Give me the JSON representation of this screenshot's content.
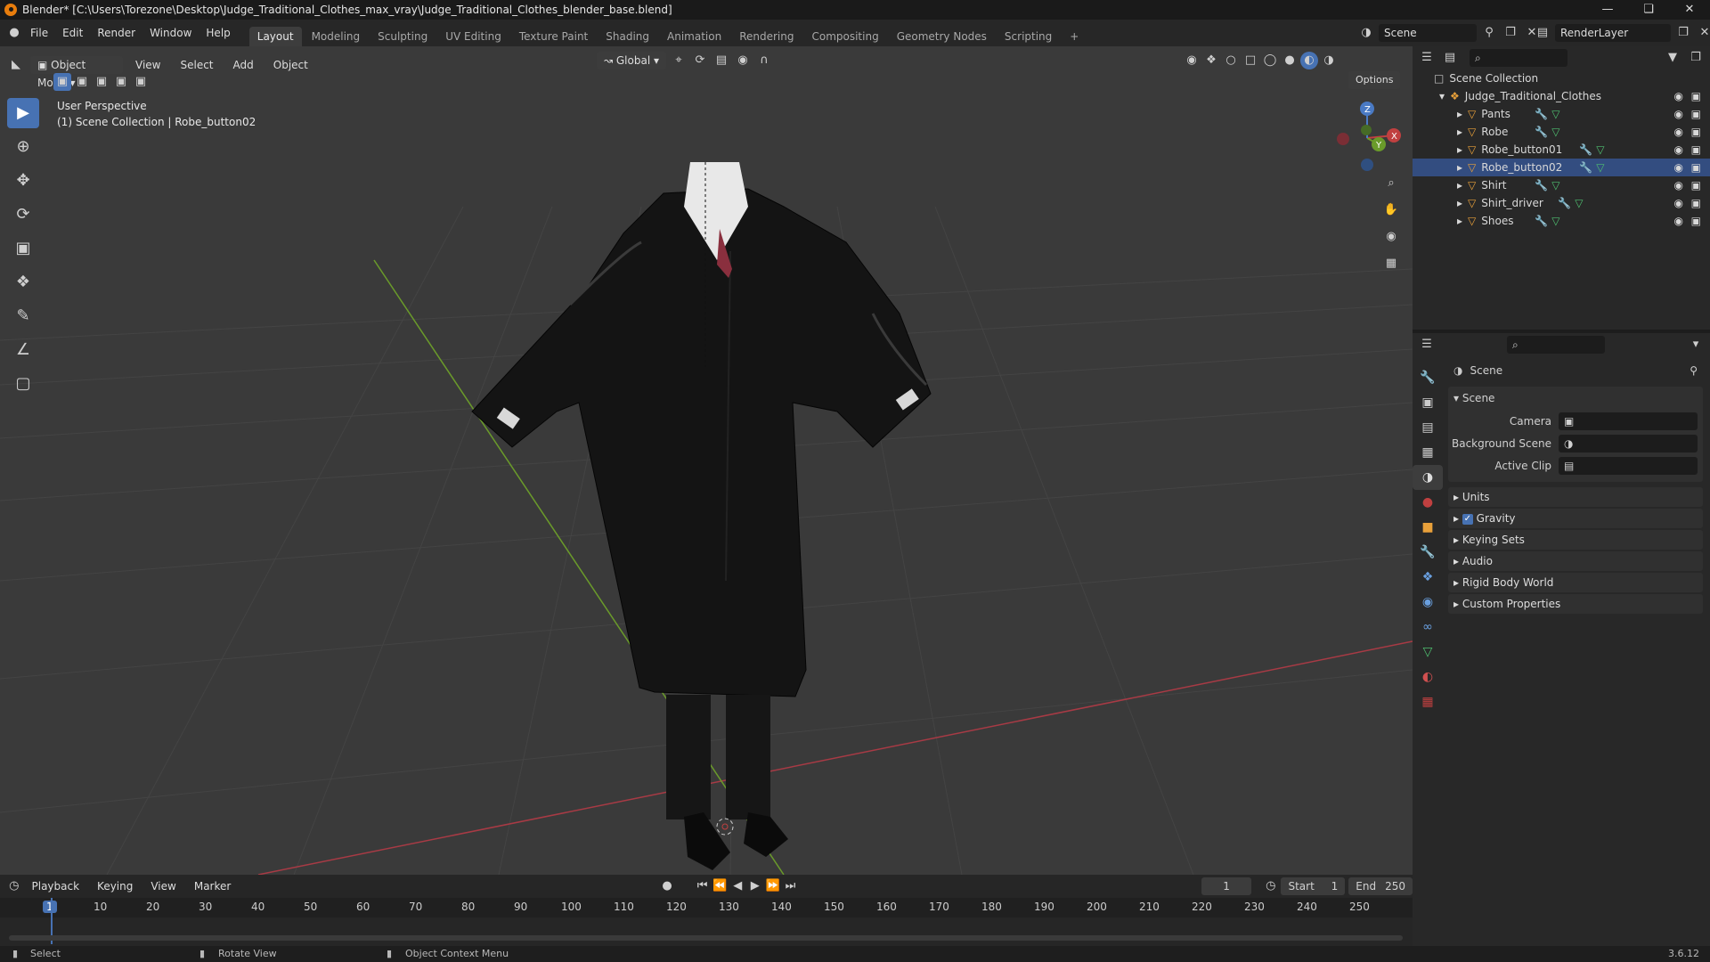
{
  "window": {
    "title": "Blender* [C:\\Users\\Torezone\\Desktop\\Judge_Traditional_Clothes_max_vray\\Judge_Traditional_Clothes_blender_base.blend]"
  },
  "menu": {
    "items": [
      "File",
      "Edit",
      "Render",
      "Window",
      "Help"
    ]
  },
  "workspaces": [
    "Layout",
    "Modeling",
    "Sculpting",
    "UV Editing",
    "Texture Paint",
    "Shading",
    "Animation",
    "Rendering",
    "Compositing",
    "Geometry Nodes",
    "Scripting"
  ],
  "active_workspace": "Layout",
  "scene_selector": "Scene",
  "render_layer": "RenderLayer",
  "viewport_header": {
    "mode": "Object Mode",
    "menus": [
      "View",
      "Select",
      "Add",
      "Object"
    ],
    "orientation": "Global",
    "options": "Options"
  },
  "viewport": {
    "perspective": "User Perspective",
    "collection": "(1) Scene Collection | Robe_button02",
    "gizmo": {
      "x": "X",
      "y": "Y",
      "z": "Z"
    },
    "grid_color": "#464646",
    "x_axis_color": "#a83a45",
    "y_axis_color": "#6a9b2a"
  },
  "outliner": {
    "root": "Scene Collection",
    "collection": "Judge_Traditional_Clothes",
    "objects": [
      "Pants",
      "Robe",
      "Robe_button01",
      "Robe_button02",
      "Shirt",
      "Shirt_driver",
      "Shoes"
    ],
    "selected": "Robe_button02"
  },
  "properties": {
    "context": "Scene",
    "panel": "Scene",
    "camera_label": "Camera",
    "background_scene_label": "Background Scene",
    "active_clip_label": "Active Clip",
    "collapsed_panels": [
      "Units",
      "Gravity",
      "Keying Sets",
      "Audio",
      "Rigid Body World",
      "Custom Properties"
    ],
    "gravity_checked": true
  },
  "timeline": {
    "menus": [
      "Playback",
      "Keying",
      "View",
      "Marker"
    ],
    "current_frame": "1",
    "start_label": "Start",
    "start": "1",
    "end_label": "End",
    "end": "250",
    "ticks": [
      "1",
      "10",
      "20",
      "30",
      "40",
      "50",
      "60",
      "70",
      "80",
      "90",
      "100",
      "110",
      "120",
      "130",
      "140",
      "150",
      "160",
      "170",
      "180",
      "190",
      "200",
      "210",
      "220",
      "230",
      "240",
      "250"
    ]
  },
  "statusbar": {
    "select": "Select",
    "rotate": "Rotate View",
    "context_menu": "Object Context Menu",
    "version": "3.6.12"
  },
  "colors": {
    "accent": "#4772b3",
    "object_orange": "#e8a03a",
    "modifier_blue": "#6aa0e0",
    "mesh_green": "#4fbf70"
  }
}
